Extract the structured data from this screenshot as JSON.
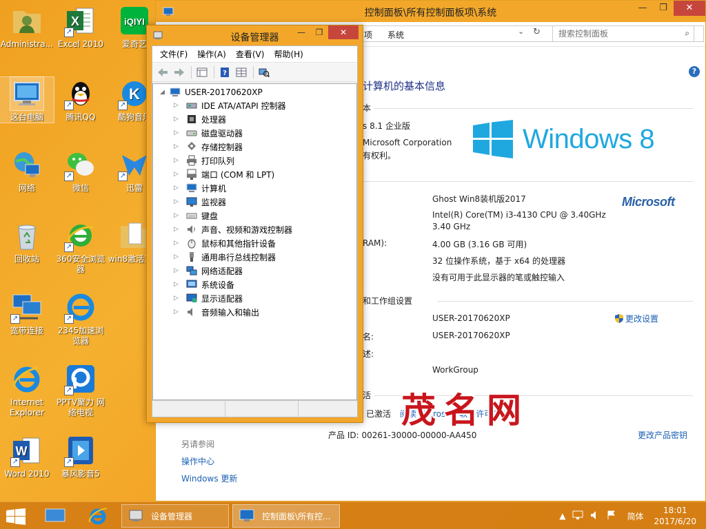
{
  "desktop": {
    "icons": [
      {
        "label": "Administra..."
      },
      {
        "label": "Excel 2010"
      },
      {
        "label": "爱奇艺"
      },
      {
        "label": "这台电脑"
      },
      {
        "label": "腾讯QQ"
      },
      {
        "label": "酷狗音乐"
      },
      {
        "label": "网络"
      },
      {
        "label": "微信"
      },
      {
        "label": "迅雷"
      },
      {
        "label": "回收站"
      },
      {
        "label": "360安全浏览器"
      },
      {
        "label": "win8激活工具"
      },
      {
        "label": "宽带连接"
      },
      {
        "label": "2345加速浏览器"
      },
      {
        "label": "Internet Explorer"
      },
      {
        "label": "PPTV聚力 网络电视"
      },
      {
        "label": "Word 2010"
      },
      {
        "label": "暴风影音5"
      }
    ],
    "watermark": "茂名网"
  },
  "control_panel": {
    "title": "控制面板\\所有控制面板项\\系统",
    "address_crumb_1": "项",
    "address_crumb_2": "系统",
    "search_placeholder": "搜索控制面板",
    "heading": "计算机的基本信息",
    "section_edition": "本",
    "edition_name": "s 8.1 企业版",
    "copyright_1": "Microsoft Corporation",
    "copyright_2": "有权利。",
    "win8_text": "Windows 8",
    "ms_logo": "Microsoft",
    "manufacturer_value": "Ghost Win8装机版2017",
    "processor_value_1": "Intel(R) Core(TM) i3-4130 CPU @ 3.40GHz",
    "processor_value_2": "3.40 GHz",
    "ram_label": "RAM):",
    "ram_value": "4.00 GB (3.16 GB 可用)",
    "system_type_value": "32 位操作系统，基于 x64 的处理器",
    "pen_value": "没有可用于此显示器的笔或触控输入",
    "section_computer": "和工作组设置",
    "computer_name_value": "USER-20170620XP",
    "change_settings": "更改设置",
    "full_name_label": "名:",
    "full_name_value": "USER-20170620XP",
    "description_label": "述:",
    "workgroup_value": "WorkGroup",
    "section_activation": "活",
    "activation_status": "已激活",
    "license_link": "阅读 Microsoft 软件许可条款",
    "product_id": "产品 ID: 00261-30000-00000-AA450",
    "change_key": "更改产品密钥",
    "see_also": "另请参阅",
    "action_center": "操作中心",
    "windows_update": "Windows 更新"
  },
  "device_manager": {
    "title": "设备管理器",
    "menu": [
      "文件(F)",
      "操作(A)",
      "查看(V)",
      "帮助(H)"
    ],
    "root": "USER-20170620XP",
    "items": [
      "IDE ATA/ATAPI 控制器",
      "处理器",
      "磁盘驱动器",
      "存储控制器",
      "打印队列",
      "端口 (COM 和 LPT)",
      "计算机",
      "监视器",
      "键盘",
      "声音、视频和游戏控制器",
      "鼠标和其他指针设备",
      "通用串行总线控制器",
      "网络适配器",
      "系统设备",
      "显示适配器",
      "音频输入和输出"
    ]
  },
  "taskbar": {
    "task_device_manager": "设备管理器",
    "task_control_panel": "控制面板\\所有控...",
    "ime": "简体",
    "time": "18:01",
    "date": "2017/6/20"
  }
}
